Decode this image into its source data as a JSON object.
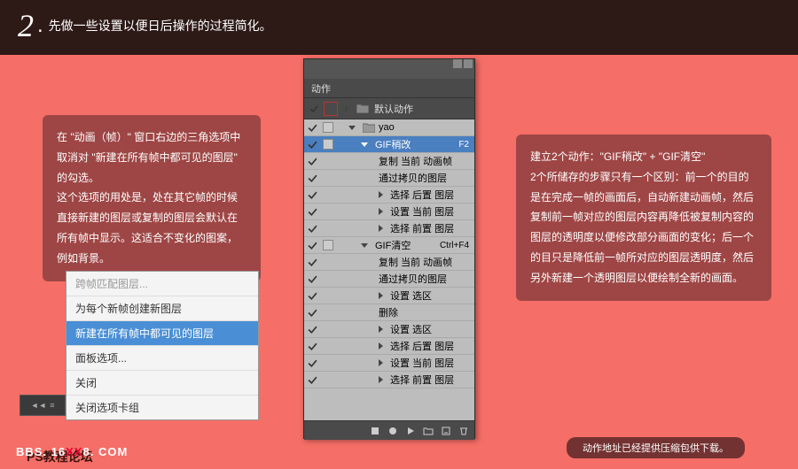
{
  "header": {
    "step_number": "2",
    "step_dot": ".",
    "step_text": "先做一些设置以便日后操作的过程简化。"
  },
  "left_note": "在 \"动画（帧）\" 窗口右边的三角选项中取消对 \"新建在所有帧中都可见的图层\" 的勾选。\n这个选项的用处是，处在其它帧的时候直接新建的图层或复制的图层会默认在所有帧中显示。这适合不变化的图案，例如背景。",
  "right_note": "建立2个动作：\"GIF稍改\" + \"GIF清空\"\n2个所储存的步骤只有一个区别：前一个的目的是在完成一帧的画面后，自动新建动画帧，然后复制前一帧对应的图层内容再降低被复制内容的图层的透明度以便修改部分画面的变化；后一个的目只是降低前一帧所对应的图层透明度，然后另外新建一个透明图层以便绘制全新的画面。",
  "context_menu": {
    "items": [
      {
        "label": "跨帧匹配图层...",
        "dim": true
      },
      {
        "label": "为每个新帧创建新图层",
        "dim": false
      },
      {
        "label": "新建在所有帧中都可见的图层",
        "highlight": true
      },
      {
        "label": "面板选项...",
        "dim": false
      },
      {
        "label": "关闭",
        "dim": false
      },
      {
        "label": "关闭选项卡组",
        "dim": false
      }
    ]
  },
  "actions_panel": {
    "title": "动作",
    "default_set": "默认动作",
    "set_name": "yao",
    "action1": {
      "name": "GIF稍改",
      "shortcut": "F2"
    },
    "action2": {
      "name": "GIF清空",
      "shortcut": "Ctrl+F4"
    },
    "steps1": [
      "复制 当前 动画帧",
      "通过拷贝的图层",
      "选择 后置 图层",
      "设置 当前 图层",
      "选择 前置 图层"
    ],
    "steps2": [
      "复制 当前 动画帧",
      "通过拷贝的图层",
      "设置 选区",
      "删除",
      "设置 选区",
      "选择 后置 图层",
      "设置 当前 图层",
      "选择 前置 图层"
    ]
  },
  "footer_note": "动作地址已经提供压缩包供下载。",
  "credit": "PS教程论坛",
  "credit_url_prefix": "BBS. 16",
  "credit_url_mid": "XX",
  "credit_url_suffix": "8. COM"
}
